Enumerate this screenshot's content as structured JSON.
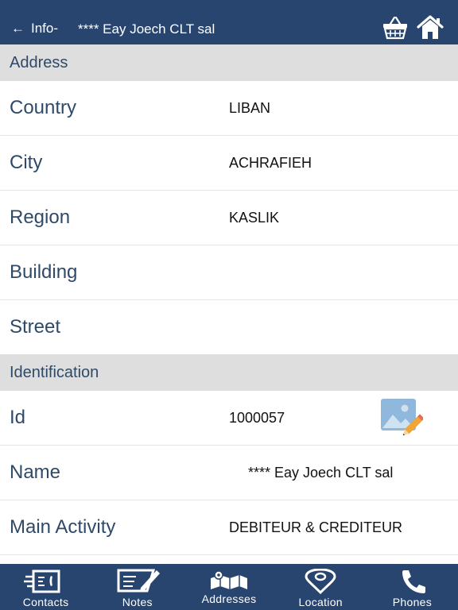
{
  "header": {
    "back_label": "Info-",
    "title": "**** Eay Joech CLT sal"
  },
  "sections": [
    {
      "title": "Address",
      "rows": [
        {
          "label": "Country",
          "value": "LIBAN"
        },
        {
          "label": "City",
          "value": "ACHRAFIEH"
        },
        {
          "label": "Region",
          "value": "KASLIK"
        },
        {
          "label": "Building",
          "value": ""
        },
        {
          "label": "Street",
          "value": ""
        }
      ]
    },
    {
      "title": "Identification",
      "rows": [
        {
          "label": "Id",
          "value": "1000057"
        },
        {
          "label": "Name",
          "value": "**** Eay Joech CLT sal"
        },
        {
          "label": "Main Activity",
          "value": "DEBITEUR & CREDITEUR"
        }
      ]
    }
  ],
  "tabs": [
    {
      "label": "Contacts",
      "icon": "contacts-icon"
    },
    {
      "label": "Notes",
      "icon": "notes-icon"
    },
    {
      "label": "Addresses",
      "icon": "addresses-map-icon"
    },
    {
      "label": "Location",
      "icon": "location-pin-icon"
    },
    {
      "label": "Phones",
      "icon": "phone-icon"
    }
  ],
  "colors": {
    "bar": "#27456f",
    "section_bg": "#dedede",
    "label_text": "#2f4a68"
  }
}
